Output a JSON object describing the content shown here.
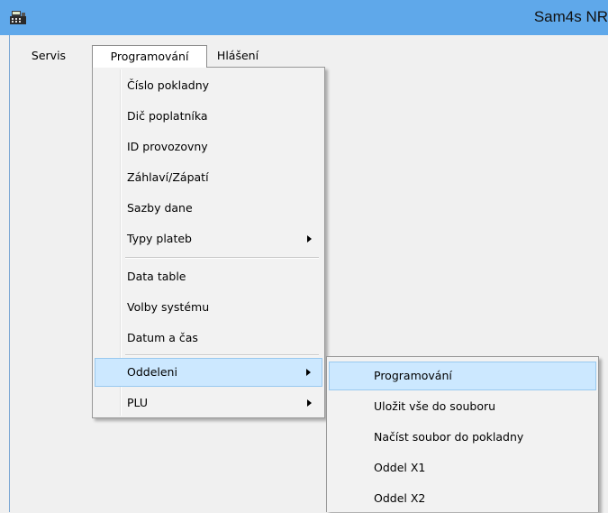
{
  "window": {
    "title": "Sam4s NR",
    "icon": "cash-register-icon",
    "accent": "#5fa8ea"
  },
  "menubar": {
    "items": [
      {
        "label": "Servis"
      },
      {
        "label": "Programování",
        "open": true
      },
      {
        "label": "Hlášení"
      }
    ]
  },
  "programovani_menu": {
    "items": [
      {
        "label": "Číslo pokladny"
      },
      {
        "label": "Dič poplatníka"
      },
      {
        "label": "ID provozovny"
      },
      {
        "label": "Záhlaví/Zápatí"
      },
      {
        "label": "Sazby dane"
      },
      {
        "label": "Typy plateb",
        "submenu": true
      },
      {
        "label": "Data table"
      },
      {
        "label": "Volby systému"
      },
      {
        "label": "Datum a čas"
      },
      {
        "label": "Oddeleni",
        "submenu": true,
        "highlighted": true
      },
      {
        "label": "PLU",
        "submenu": true
      }
    ]
  },
  "oddeleni_menu": {
    "items": [
      {
        "label": "Programování",
        "highlighted": true
      },
      {
        "label": "Uložit vše do souboru"
      },
      {
        "label": "Načíst soubor do pokladny"
      },
      {
        "label": "Oddel X1"
      },
      {
        "label": "Oddel X2"
      }
    ]
  },
  "colors": {
    "highlight_bg": "#cce8ff",
    "highlight_border": "#99c9ef"
  }
}
